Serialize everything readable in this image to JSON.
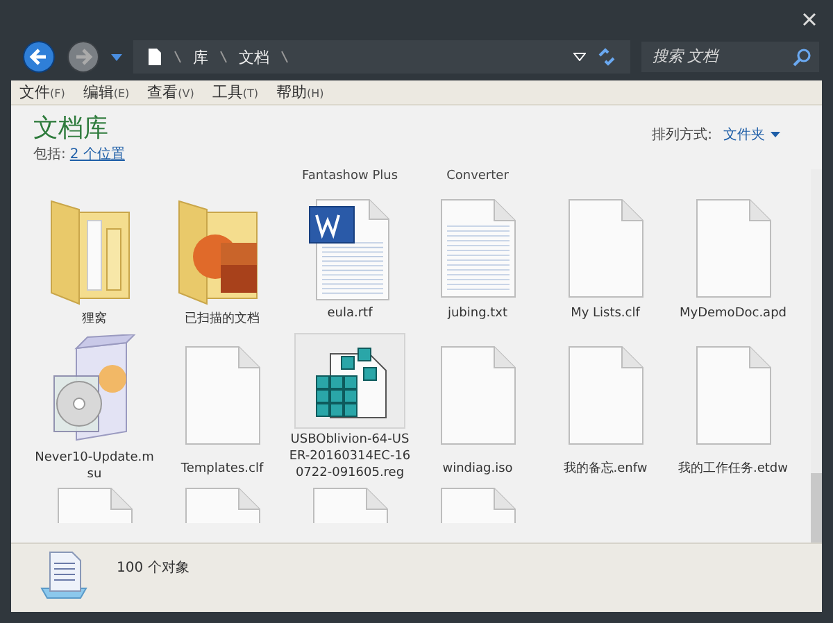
{
  "navigation": {
    "breadcrumb": [
      "库",
      "文档"
    ],
    "search": {
      "placeholder": "搜索 文档"
    }
  },
  "menu": [
    {
      "label": "文件",
      "key": "(F)"
    },
    {
      "label": "编辑",
      "key": "(E)"
    },
    {
      "label": "查看",
      "key": "(V)"
    },
    {
      "label": "工具",
      "key": "(T)"
    },
    {
      "label": "帮助",
      "key": "(H)"
    }
  ],
  "header": {
    "title": "文档库",
    "includes_label": "包括:",
    "locations_link": "2 个位置",
    "arrange_label": "排列方式:",
    "arrange_value": "文件夹"
  },
  "cut_row": [
    {
      "kind": "hidden"
    },
    {
      "kind": "hidden"
    },
    {
      "kind": "label",
      "label": "Fantashow Plus"
    },
    {
      "kind": "label",
      "label": "Converter"
    },
    {
      "kind": "hidden"
    },
    {
      "kind": "hidden"
    }
  ],
  "files": [
    {
      "kind": "folder",
      "label": "狸窝",
      "selected": false
    },
    {
      "kind": "photo-folder",
      "label": "已扫描的文档",
      "selected": false
    },
    {
      "kind": "word",
      "label": "eula.rtf",
      "selected": false
    },
    {
      "kind": "text",
      "label": "jubing.txt",
      "selected": false
    },
    {
      "kind": "blank",
      "label": "My Lists.clf",
      "selected": false
    },
    {
      "kind": "blank",
      "label": "MyDemoDoc.apd",
      "selected": false
    },
    {
      "kind": "installer",
      "label": "Never10-Update.msu",
      "selected": false
    },
    {
      "kind": "blank",
      "label": "Templates.clf",
      "selected": false
    },
    {
      "kind": "registry",
      "label": "USBOblivion-64-USER-20160314EC-160722-091605.reg",
      "selected": true
    },
    {
      "kind": "blank",
      "label": "windiag.iso",
      "selected": false
    },
    {
      "kind": "blank",
      "label": "我的备忘.enfw",
      "selected": false
    },
    {
      "kind": "blank",
      "label": "我的工作任务.etdw",
      "selected": false
    }
  ],
  "partial_row": [
    {
      "kind": "blank"
    },
    {
      "kind": "blank"
    },
    {
      "kind": "blank"
    },
    {
      "kind": "blank"
    }
  ],
  "status_bar": {
    "count": "100 个对象"
  }
}
